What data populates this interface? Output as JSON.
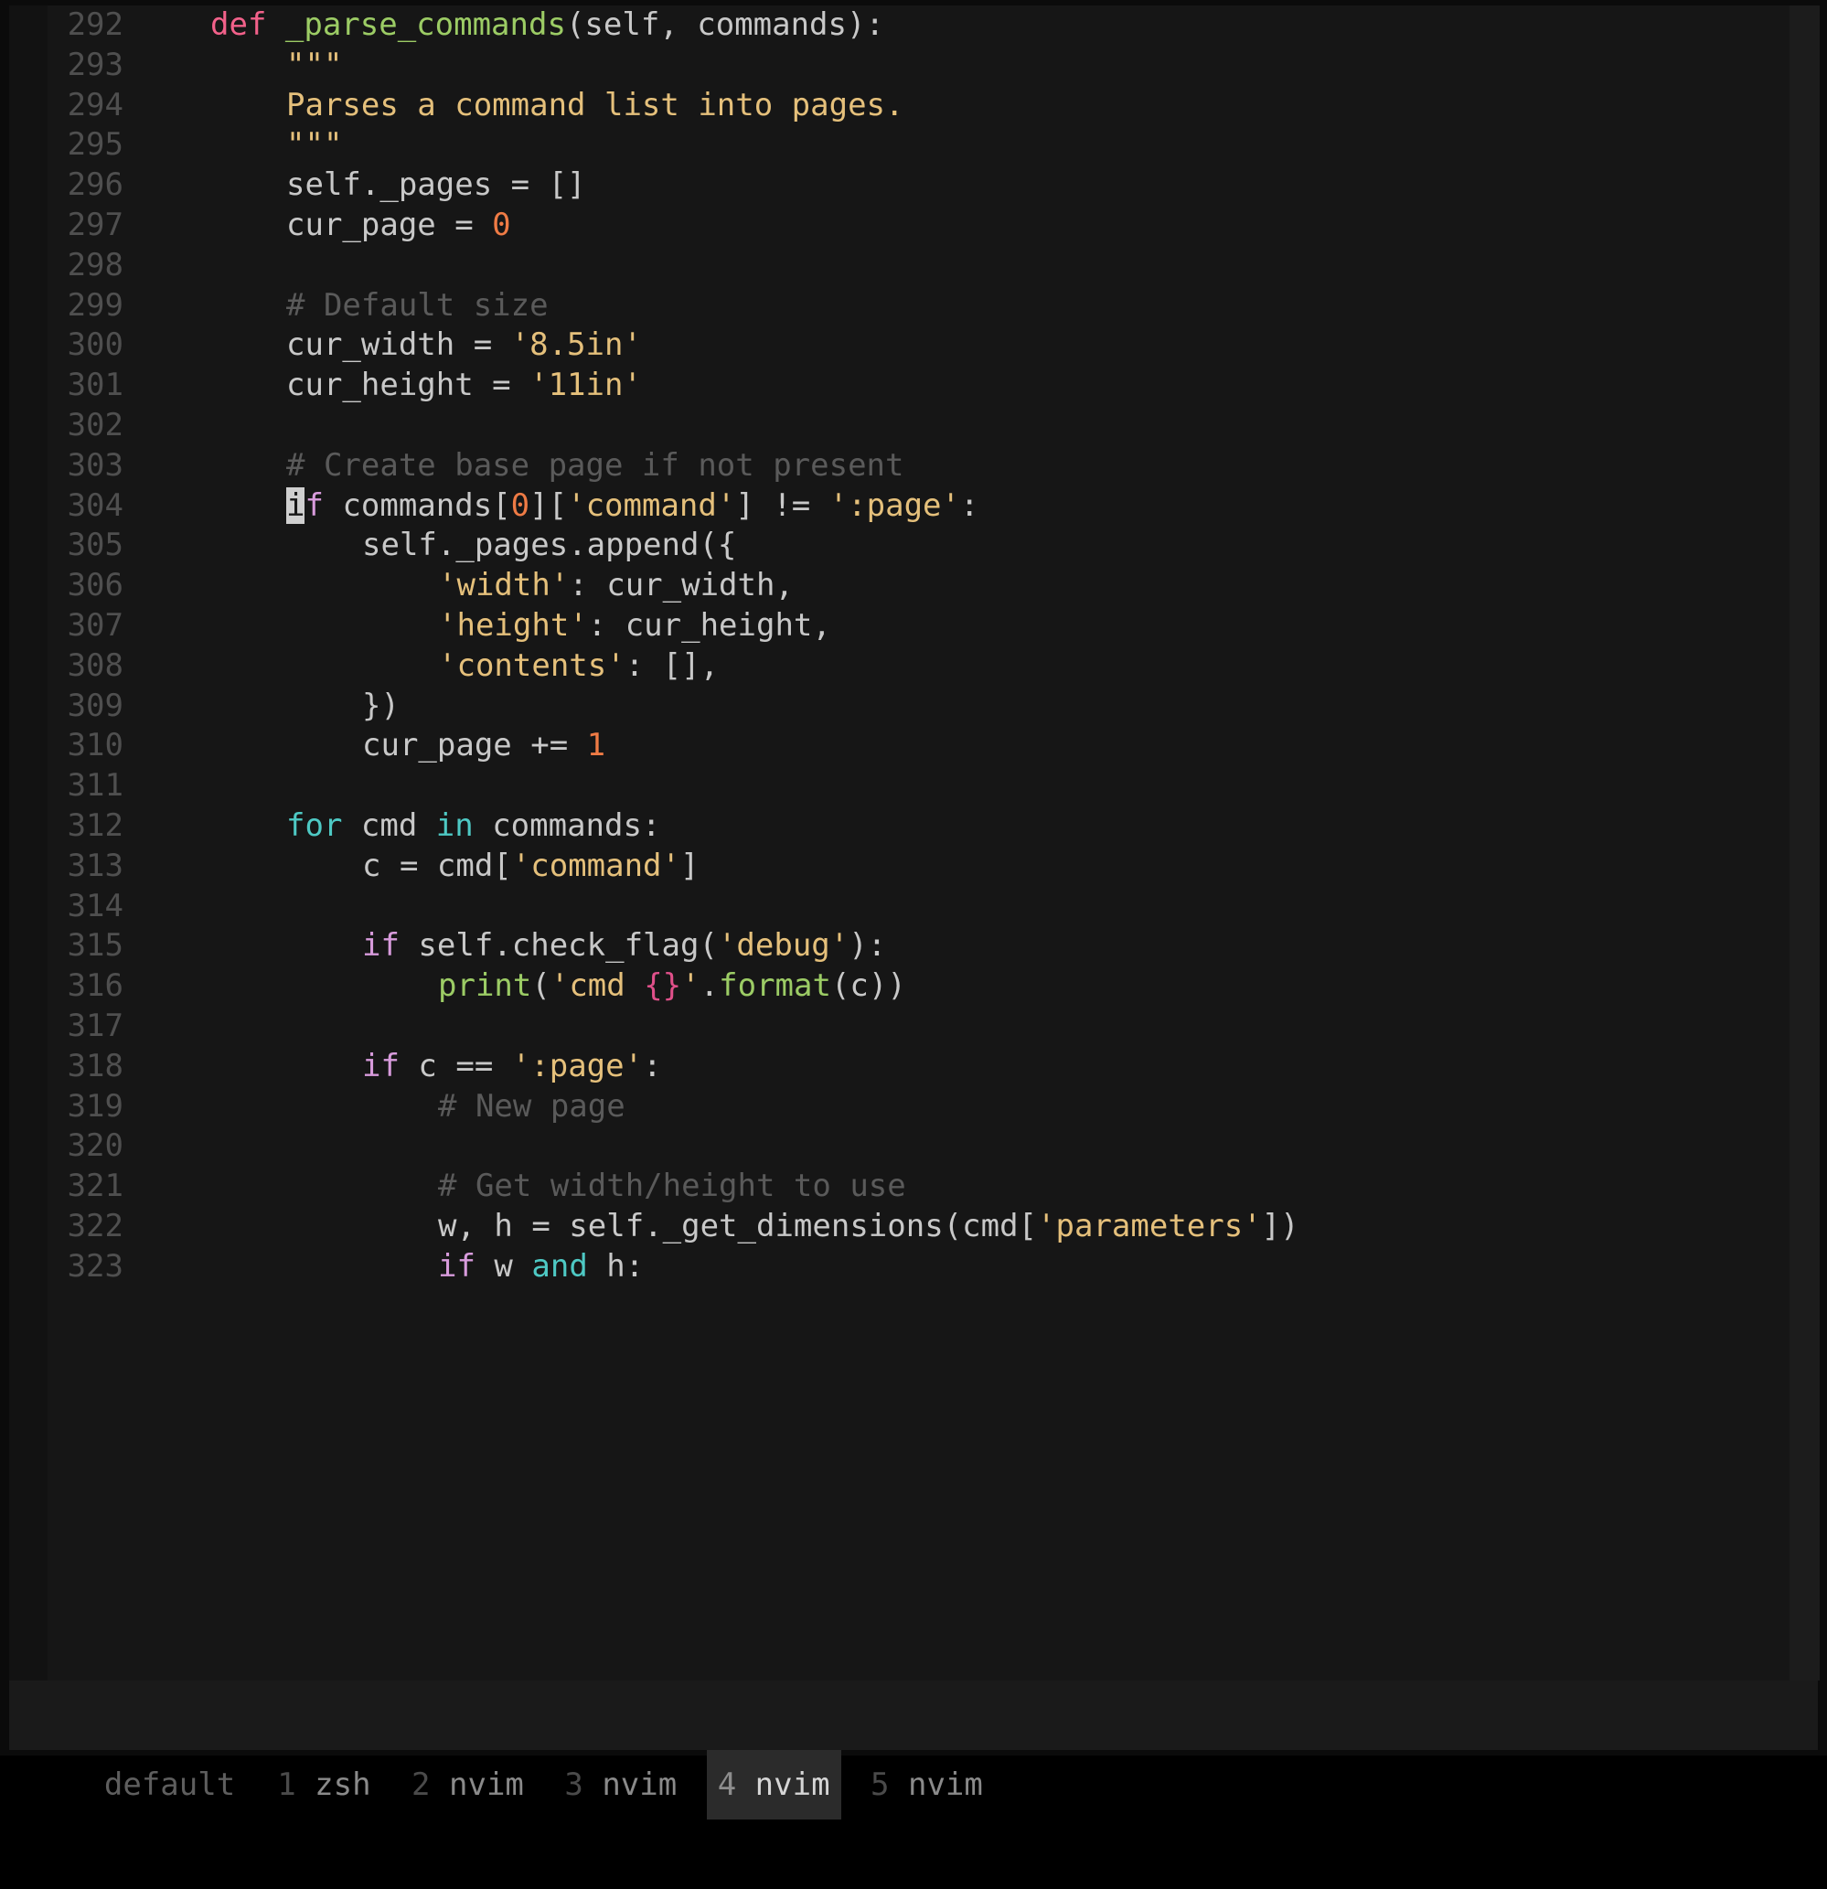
{
  "editor": {
    "first_line_number": 292,
    "cursor": {
      "line": 304,
      "column_char": "i"
    },
    "lines": [
      {
        "num": "292",
        "indent": 8,
        "tokens": [
          {
            "t": "def ",
            "c": "kw-def"
          },
          {
            "t": "_parse_commands",
            "c": "fn"
          },
          {
            "t": "(self, commands):",
            "c": "plain"
          }
        ]
      },
      {
        "num": "293",
        "indent": 12,
        "tokens": [
          {
            "t": "\"\"\"",
            "c": "str"
          }
        ]
      },
      {
        "num": "294",
        "indent": 12,
        "tokens": [
          {
            "t": "Parses a command list into pages.",
            "c": "str"
          }
        ]
      },
      {
        "num": "295",
        "indent": 12,
        "tokens": [
          {
            "t": "\"\"\"",
            "c": "str"
          }
        ]
      },
      {
        "num": "296",
        "indent": 12,
        "tokens": [
          {
            "t": "self._pages = []",
            "c": "plain"
          }
        ]
      },
      {
        "num": "297",
        "indent": 12,
        "tokens": [
          {
            "t": "cur_page = ",
            "c": "plain"
          },
          {
            "t": "0",
            "c": "num"
          }
        ]
      },
      {
        "num": "298",
        "indent": 0,
        "tokens": []
      },
      {
        "num": "299",
        "indent": 12,
        "tokens": [
          {
            "t": "# Default size",
            "c": "com"
          }
        ]
      },
      {
        "num": "300",
        "indent": 12,
        "tokens": [
          {
            "t": "cur_width = ",
            "c": "plain"
          },
          {
            "t": "'8.5in'",
            "c": "str"
          }
        ]
      },
      {
        "num": "301",
        "indent": 12,
        "tokens": [
          {
            "t": "cur_height = ",
            "c": "plain"
          },
          {
            "t": "'11in'",
            "c": "str"
          }
        ]
      },
      {
        "num": "302",
        "indent": 0,
        "tokens": []
      },
      {
        "num": "303",
        "indent": 12,
        "tokens": [
          {
            "t": "# Create base page if not present",
            "c": "com"
          }
        ]
      },
      {
        "num": "304",
        "indent": 12,
        "tokens": [
          {
            "t": "i",
            "c": "cursor"
          },
          {
            "t": "f",
            "c": "kw-cond"
          },
          {
            "t": " commands[",
            "c": "plain"
          },
          {
            "t": "0",
            "c": "num"
          },
          {
            "t": "][",
            "c": "plain"
          },
          {
            "t": "'command'",
            "c": "str"
          },
          {
            "t": "] != ",
            "c": "plain"
          },
          {
            "t": "':page'",
            "c": "str"
          },
          {
            "t": ":",
            "c": "plain"
          }
        ]
      },
      {
        "num": "305",
        "indent": 16,
        "tokens": [
          {
            "t": "self._pages.append({",
            "c": "plain"
          }
        ]
      },
      {
        "num": "306",
        "indent": 20,
        "tokens": [
          {
            "t": "'width'",
            "c": "str"
          },
          {
            "t": ": cur_width,",
            "c": "plain"
          }
        ]
      },
      {
        "num": "307",
        "indent": 20,
        "tokens": [
          {
            "t": "'height'",
            "c": "str"
          },
          {
            "t": ": cur_height,",
            "c": "plain"
          }
        ]
      },
      {
        "num": "308",
        "indent": 20,
        "tokens": [
          {
            "t": "'contents'",
            "c": "str"
          },
          {
            "t": ": [],",
            "c": "plain"
          }
        ]
      },
      {
        "num": "309",
        "indent": 16,
        "tokens": [
          {
            "t": "})",
            "c": "plain"
          }
        ]
      },
      {
        "num": "310",
        "indent": 16,
        "tokens": [
          {
            "t": "cur_page += ",
            "c": "plain"
          },
          {
            "t": "1",
            "c": "num"
          }
        ]
      },
      {
        "num": "311",
        "indent": 0,
        "tokens": []
      },
      {
        "num": "312",
        "indent": 12,
        "tokens": [
          {
            "t": "for",
            "c": "kw-flow"
          },
          {
            "t": " cmd ",
            "c": "plain"
          },
          {
            "t": "in",
            "c": "kw-flow"
          },
          {
            "t": " commands:",
            "c": "plain"
          }
        ]
      },
      {
        "num": "313",
        "indent": 16,
        "tokens": [
          {
            "t": "c = cmd[",
            "c": "plain"
          },
          {
            "t": "'command'",
            "c": "str"
          },
          {
            "t": "]",
            "c": "plain"
          }
        ]
      },
      {
        "num": "314",
        "indent": 0,
        "tokens": []
      },
      {
        "num": "315",
        "indent": 16,
        "tokens": [
          {
            "t": "if",
            "c": "kw-cond"
          },
          {
            "t": " self.check_flag(",
            "c": "plain"
          },
          {
            "t": "'debug'",
            "c": "str"
          },
          {
            "t": "):",
            "c": "plain"
          }
        ]
      },
      {
        "num": "316",
        "indent": 20,
        "tokens": [
          {
            "t": "print",
            "c": "fn"
          },
          {
            "t": "(",
            "c": "plain"
          },
          {
            "t": "'cmd ",
            "c": "str"
          },
          {
            "t": "{}",
            "c": "brace"
          },
          {
            "t": "'",
            "c": "str"
          },
          {
            "t": ".",
            "c": "plain"
          },
          {
            "t": "format",
            "c": "fn"
          },
          {
            "t": "(c))",
            "c": "plain"
          }
        ]
      },
      {
        "num": "317",
        "indent": 0,
        "tokens": []
      },
      {
        "num": "318",
        "indent": 16,
        "tokens": [
          {
            "t": "if",
            "c": "kw-cond"
          },
          {
            "t": " c == ",
            "c": "plain"
          },
          {
            "t": "':page'",
            "c": "str"
          },
          {
            "t": ":",
            "c": "plain"
          }
        ]
      },
      {
        "num": "319",
        "indent": 20,
        "tokens": [
          {
            "t": "# New page",
            "c": "com"
          }
        ]
      },
      {
        "num": "320",
        "indent": 0,
        "tokens": []
      },
      {
        "num": "321",
        "indent": 20,
        "tokens": [
          {
            "t": "# Get width/height to use",
            "c": "com"
          }
        ]
      },
      {
        "num": "322",
        "indent": 20,
        "tokens": [
          {
            "t": "w, h = self._get_dimensions(cmd[",
            "c": "plain"
          },
          {
            "t": "'parameters'",
            "c": "str"
          },
          {
            "t": "])",
            "c": "plain"
          }
        ]
      },
      {
        "num": "323",
        "indent": 20,
        "tokens": [
          {
            "t": "if",
            "c": "kw-cond"
          },
          {
            "t": " w ",
            "c": "plain"
          },
          {
            "t": "and",
            "c": "kw-flow"
          },
          {
            "t": " h:",
            "c": "plain"
          }
        ]
      }
    ]
  },
  "status_bar": {
    "session": "default",
    "windows": [
      {
        "index": "1",
        "name": "zsh",
        "active": false
      },
      {
        "index": "2",
        "name": "nvim",
        "active": false
      },
      {
        "index": "3",
        "name": "nvim",
        "active": false
      },
      {
        "index": "4",
        "name": "nvim",
        "active": true
      },
      {
        "index": "5",
        "name": "nvim",
        "active": false
      }
    ]
  },
  "colors": {
    "background": "#161616",
    "gutter_text": "#4f4f4f",
    "foreground": "#c8c8c8",
    "keyword_def": "#f2618a",
    "function": "#9ccc65",
    "keyword_flow": "#4ec9c4",
    "keyword_cond": "#d89bdc",
    "string": "#e5c07b",
    "number": "#ef7b45",
    "comment": "#5a5a5a",
    "brace": "#e0508a",
    "cursor_bg": "#cfcfcf",
    "status_bg": "#1a1a1a",
    "status_active_bg": "#2b2b2b"
  }
}
